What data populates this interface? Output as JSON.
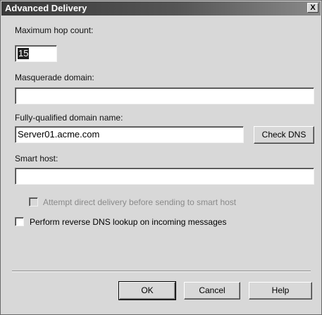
{
  "window": {
    "title": "Advanced Delivery",
    "close_glyph": "X"
  },
  "fields": {
    "max_hop_label": "Maximum hop count:",
    "max_hop_value": "15",
    "masquerade_label": "Masquerade domain:",
    "masquerade_value": "",
    "fqdn_label": "Fully-qualified domain name:",
    "fqdn_value": "Server01.acme.com",
    "smart_host_label": "Smart host:",
    "smart_host_value": ""
  },
  "buttons": {
    "check_dns": "Check DNS",
    "ok": "OK",
    "cancel": "Cancel",
    "help": "Help"
  },
  "checkboxes": {
    "direct_delivery": {
      "label": "Attempt direct delivery before sending to smart host",
      "checked": false,
      "enabled": false
    },
    "reverse_dns": {
      "label": "Perform reverse DNS lookup on incoming messages",
      "checked": false,
      "enabled": true
    }
  }
}
